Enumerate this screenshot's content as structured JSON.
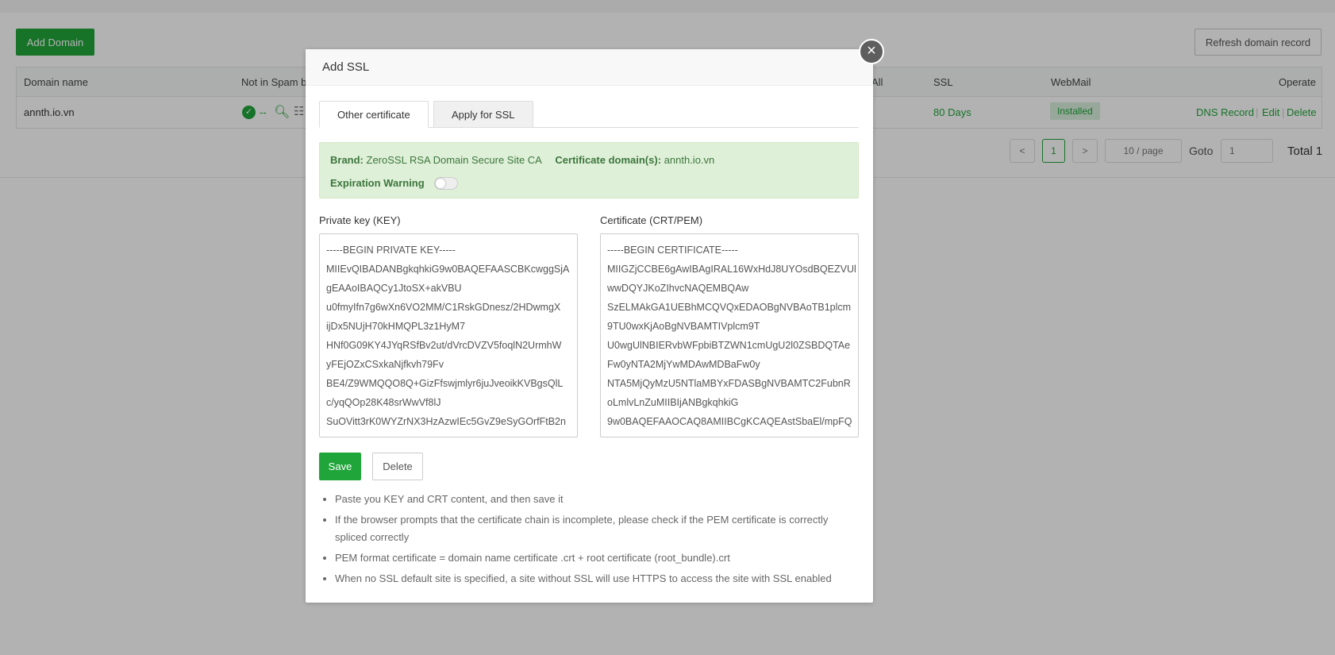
{
  "background": {
    "add_domain_label": "Add Domain",
    "refresh_label": "Refresh domain record",
    "columns": {
      "domain_name": "Domain name",
      "not_in_spam": "Not in Spam b",
      "catch_all": "All",
      "ssl": "SSL",
      "webmail": "WebMail",
      "operate": "Operate"
    },
    "row": {
      "domain": "annth.io.vn",
      "spam_status": "--",
      "ssl_days": "80 Days",
      "webmail": "Installed",
      "dns_record": "DNS Record",
      "edit": "Edit",
      "delete": "Delete",
      "sep1": "|",
      "sep2": "|"
    },
    "pagination": {
      "prev": "<",
      "page": "1",
      "next": ">",
      "per_page": "10 / page",
      "goto_label": "Goto",
      "goto_value": "1",
      "total": "Total 1"
    }
  },
  "modal": {
    "title": "Add SSL",
    "close_symbol": "×",
    "tabs": [
      {
        "label": "Other certificate",
        "active": true
      },
      {
        "label": "Apply for SSL",
        "active": false
      }
    ],
    "info": {
      "brand_label": "Brand:",
      "brand_value": "ZeroSSL RSA Domain Secure Site CA",
      "domains_label": "Certificate domain(s):",
      "domains_value": "annth.io.vn",
      "expiration_label": "Expiration Warning",
      "expiration_enabled": false
    },
    "private_key": {
      "label": "Private key (KEY)",
      "value": "-----BEGIN PRIVATE KEY-----\nMIIEvQIBADANBgkqhkiG9w0BAQEFAASCBKcwggSjA\ngEAAoIBAQCy1JtoSX+akVBU\nu0fmyIfn7g6wXn6VO2MM/C1RskGDnesz/2HDwmgX\nijDx5NUjH70kHMQPL3z1HyM7\nHNf0G09KY4JYqRSfBv2ut/dVrcDVZV5foqlN2UrmhW\nyFEjOZxCSxkaNjfkvh79Fv\nBE4/Z9WMQQO8Q+GizFfswjmlyr6juJveoikKVBgsQlL\nc/yqQOp28K48srWwVf8lJ\nSuOVitt3rK0WYZrNX3HzAzwIEc5GvZ9eSyGOrfFtB2n"
    },
    "certificate": {
      "label": "Certificate (CRT/PEM)",
      "value": "-----BEGIN CERTIFICATE-----\nMIIGZjCCBE6gAwIBAgIRAL16WxHdJ8UYOsdBQEZVUl\nwwDQYJKoZIhvcNAQEMBQAw\nSzELMAkGA1UEBhMCQVQxEDAOBgNVBAoTB1plcm\n9TU0wxKjAoBgNVBAMTIVplcm9T\nU0wgUlNBIERvbWFpbiBTZWN1cmUgU2l0ZSBDQTAe\nFw0yNTA2MjYwMDAwMDBaFw0y\nNTA5MjQyMzU5NTlaMBYxFDASBgNVBAMTC2FubnR\noLmlvLnZuMIIBIjANBgkqhkiG\n9w0BAQEFAAOCAQ8AMIIBCgKCAQEAstSbaEl/mpFQ"
    },
    "save_label": "Save",
    "delete_label": "Delete",
    "tips": [
      "Paste you KEY and CRT content, and then save it",
      "If the browser prompts that the certificate chain is incomplete, please check if the PEM certificate is correctly spliced correctly",
      "PEM format certificate = domain name certificate .crt + root certificate (root_bundle).crt",
      "When no SSL default site is specified, a site without SSL will use HTTPS to access the site with SSL enabled"
    ]
  },
  "colors": {
    "accent": "#20a53a",
    "info_bg": "#dff0d8",
    "info_text": "#3c763d"
  }
}
